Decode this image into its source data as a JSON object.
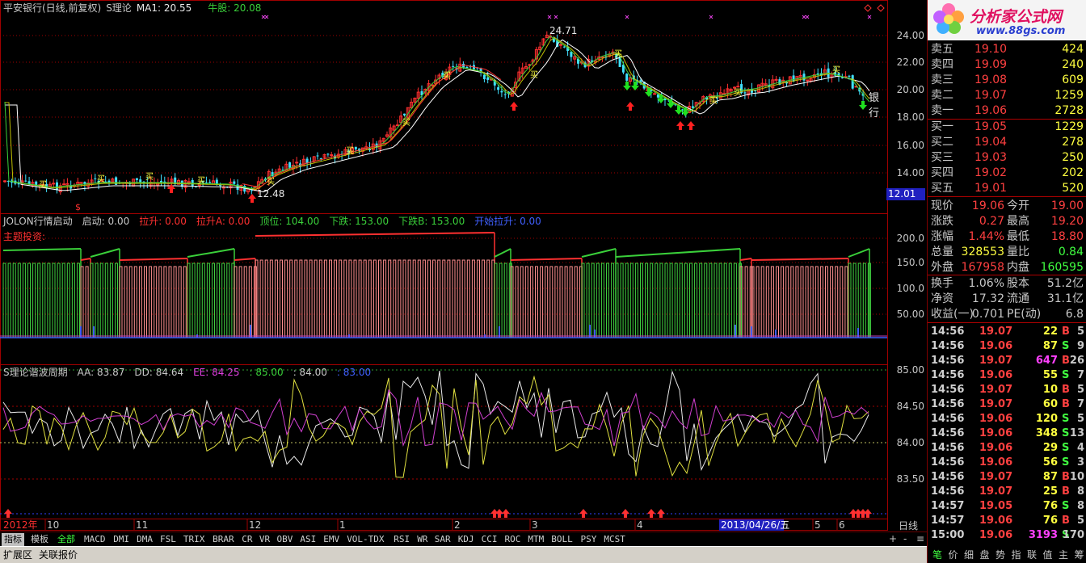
{
  "colors": {
    "up": "#ff3030",
    "down": "#40e0ff",
    "ma": "#ffffff",
    "green": "#3ad03a",
    "yellow": "#ffff40",
    "magenta": "#e040e0",
    "blue": "#4060ff",
    "grid": "#a00000"
  },
  "main": {
    "title_stock": "平安银行(日线,前复权)",
    "title_theory": "S理论",
    "ma_label": "MA1: 20.55",
    "bull_label": "牛股: 20.08",
    "high_label": "24.71",
    "low_label": "12.48",
    "stock_tag": "银行",
    "current_price_tag": "12.01",
    "buy_label": "买",
    "yticks": [
      "24.00",
      "22.00",
      "20.00",
      "18.00",
      "16.00",
      "14.00"
    ]
  },
  "ind1": {
    "name": "JOLON行情启动",
    "items": [
      {
        "t": "启动: 0.00",
        "c": "#c8c8c8"
      },
      {
        "t": "拉升: 0.00",
        "c": "#ff3030"
      },
      {
        "t": "拉升A: 0.00",
        "c": "#ff3030"
      },
      {
        "t": "顶位: 104.00",
        "c": "#3ad03a"
      },
      {
        "t": "下跌: 153.00",
        "c": "#3ad03a"
      },
      {
        "t": "下跌B: 153.00",
        "c": "#3ad03a"
      },
      {
        "t": "开始拉升: 0.00",
        "c": "#4060ff"
      }
    ],
    "subtitle": "主题投资:",
    "yticks": [
      "200.0",
      "150.0",
      "100.0",
      "50.00"
    ]
  },
  "ind2": {
    "name": "S理论谐波周期",
    "items": [
      {
        "t": "AA: 83.87",
        "c": "#c8c8c8"
      },
      {
        "t": "DD: 84.64",
        "c": "#c8c8c8"
      },
      {
        "t": "EE: 84.25",
        "c": "#e040e0"
      },
      {
        "t": ": 85.00",
        "c": "#3ad03a"
      },
      {
        "t": ": 84.00",
        "c": "#c8c8c8"
      },
      {
        "t": ": 83.00",
        "c": "#4060ff"
      }
    ],
    "yticks": [
      "85.00",
      "84.50",
      "84.00",
      "83.50"
    ]
  },
  "xaxis": {
    "labels": [
      "2012年",
      "10",
      "11",
      "12",
      "1",
      "2",
      "3",
      "4",
      "2013/04/26/五",
      "5",
      "6"
    ],
    "period": "日线"
  },
  "tabs": [
    "指标",
    "模板",
    "全部",
    "MACD",
    "DMI",
    "DMA",
    "FSL",
    "TRIX",
    "BRAR",
    "CR",
    "VR",
    "OBV",
    "ASI",
    "EMV",
    "VOL-TDX",
    "RSI",
    "WR",
    "SAR",
    "KDJ",
    "CCI",
    "ROC",
    "MTM",
    "BOLL",
    "PSY",
    "MCST"
  ],
  "bottom": {
    "ext": "扩展区",
    "related": "关联报价",
    "plus": "+",
    "minus": "-",
    "menu": "≡"
  },
  "logo": {
    "title": "分析家公式网",
    "url": "www.88gs.com"
  },
  "sell": [
    {
      "l": "卖五",
      "p": "19.10",
      "v": "424"
    },
    {
      "l": "卖四",
      "p": "19.09",
      "v": "240"
    },
    {
      "l": "卖三",
      "p": "19.08",
      "v": "609"
    },
    {
      "l": "卖二",
      "p": "19.07",
      "v": "1259"
    },
    {
      "l": "卖一",
      "p": "19.06",
      "v": "2728"
    }
  ],
  "buy": [
    {
      "l": "买一",
      "p": "19.05",
      "v": "1229"
    },
    {
      "l": "买二",
      "p": "19.04",
      "v": "278"
    },
    {
      "l": "买三",
      "p": "19.03",
      "v": "250"
    },
    {
      "l": "买四",
      "p": "19.02",
      "v": "202"
    },
    {
      "l": "买五",
      "p": "19.01",
      "v": "520"
    }
  ],
  "stats": [
    {
      "a": "现价",
      "b": "19.06",
      "bc": "#ff4040",
      "c": "今开",
      "d": "19.00",
      "dc": "#ff4040"
    },
    {
      "a": "涨跌",
      "b": "0.27",
      "bc": "#ff4040",
      "c": "最高",
      "d": "19.20",
      "dc": "#ff4040"
    },
    {
      "a": "涨幅",
      "b": "1.44%",
      "bc": "#ff4040",
      "c": "最低",
      "d": "18.80",
      "dc": "#ff4040"
    },
    {
      "a": "总量",
      "b": "328553",
      "bc": "#ffff40",
      "c": "量比",
      "d": "0.84",
      "dc": "#40ff40"
    },
    {
      "a": "外盘",
      "b": "167958",
      "bc": "#ff4040",
      "c": "内盘",
      "d": "160595",
      "dc": "#40ff40"
    }
  ],
  "stats2": [
    {
      "a": "换手",
      "b": "1.06%",
      "bc": "#c8c8c8",
      "c": "股本",
      "d": "51.2亿",
      "dc": "#c8c8c8"
    },
    {
      "a": "净资",
      "b": "17.32",
      "bc": "#c8c8c8",
      "c": "流通",
      "d": "31.1亿",
      "dc": "#c8c8c8"
    },
    {
      "a": "收益(一)",
      "b": "0.701",
      "bc": "#c8c8c8",
      "c": "PE(动)",
      "d": "6.8",
      "dc": "#c8c8c8"
    }
  ],
  "ticks": [
    {
      "t": "14:56",
      "p": "19.07",
      "v": "22",
      "s": "B",
      "n": "5"
    },
    {
      "t": "14:56",
      "p": "19.06",
      "v": "87",
      "s": "S",
      "n": "9"
    },
    {
      "t": "14:56",
      "p": "19.07",
      "v": "647",
      "s": "B",
      "n": "26"
    },
    {
      "t": "14:56",
      "p": "19.06",
      "v": "55",
      "s": "S",
      "n": "7"
    },
    {
      "t": "14:56",
      "p": "19.07",
      "v": "10",
      "s": "B",
      "n": "5"
    },
    {
      "t": "14:56",
      "p": "19.07",
      "v": "60",
      "s": "B",
      "n": "7"
    },
    {
      "t": "14:56",
      "p": "19.06",
      "v": "120",
      "s": "S",
      "n": "5"
    },
    {
      "t": "14:56",
      "p": "19.06",
      "v": "348",
      "s": "S",
      "n": "13"
    },
    {
      "t": "14:56",
      "p": "19.06",
      "v": "29",
      "s": "S",
      "n": "4"
    },
    {
      "t": "14:56",
      "p": "19.06",
      "v": "56",
      "s": "S",
      "n": "3"
    },
    {
      "t": "14:56",
      "p": "19.07",
      "v": "87",
      "s": "B",
      "n": "10"
    },
    {
      "t": "14:56",
      "p": "19.07",
      "v": "25",
      "s": "B",
      "n": "8"
    },
    {
      "t": "14:57",
      "p": "19.05",
      "v": "76",
      "s": "S",
      "n": "8"
    },
    {
      "t": "14:57",
      "p": "19.06",
      "v": "76",
      "s": "B",
      "n": "5"
    },
    {
      "t": "15:00",
      "p": "19.06",
      "v": "3193",
      "s": "S",
      "n": "170"
    }
  ],
  "rtabs": [
    "笔",
    "价",
    "细",
    "盘",
    "势",
    "指",
    "联",
    "值",
    "主",
    "筹"
  ]
}
